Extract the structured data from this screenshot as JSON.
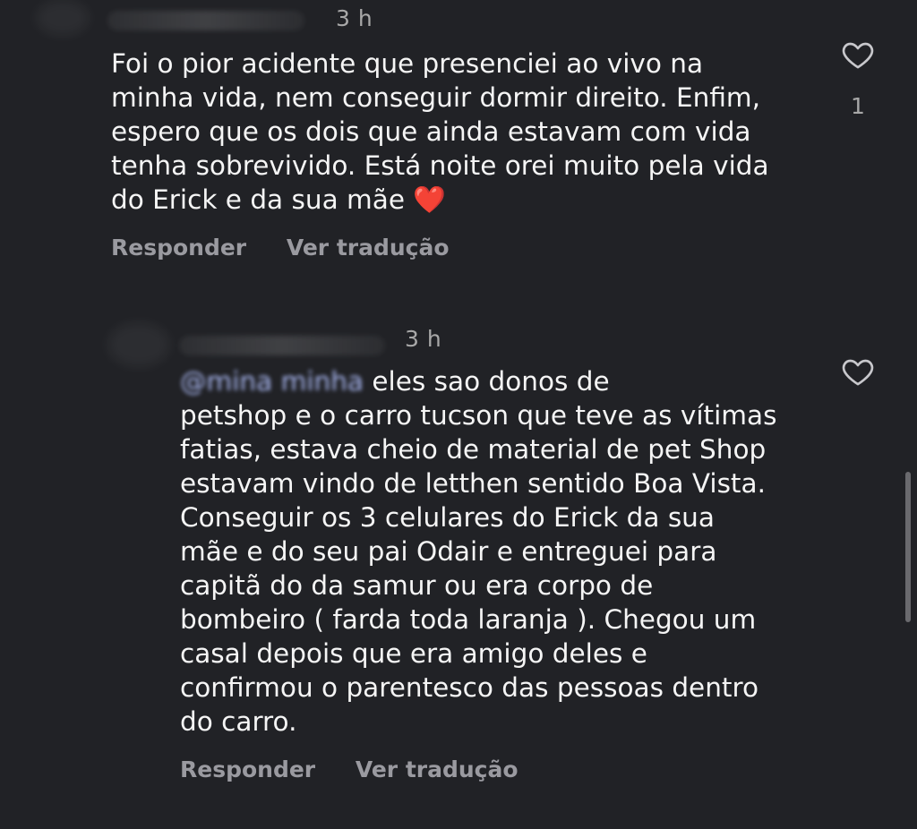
{
  "comments": [
    {
      "timestamp": "3 h",
      "text": "Foi o pior acidente que presenciei ao vivo na\nminha vida, nem conseguir dormir direito. Enfim,\nespero que os dois que ainda estavam com vida\ntenha sobrevivido. Está noite orei muito pela vida\ndo Erick e da sua mãe",
      "emoji": "❤️",
      "like_count": "1",
      "reply_label": "Responder",
      "translate_label": "Ver tradução"
    },
    {
      "timestamp": "3 h",
      "mention": "@mina minha",
      "text": "eles sao donos de\npetshop e o carro tucson que teve as vítimas\nfatias, estava cheio de material de pet Shop\nestavam vindo de letthen sentido Boa Vista.\nConseguir os 3 celulares do Erick da sua\nmãe e do seu pai Odair e entreguei para\ncapitã do da samur ou era corpo de\nbombeiro ( farda toda laranja ). Chegou um\ncasal depois que era amigo deles e\nconfirmou o parentesco das pessoas dentro\ndo carro.",
      "reply_label": "Responder",
      "translate_label": "Ver tradução"
    }
  ],
  "colors": {
    "background": "#212226",
    "text": "#f5f5f5",
    "muted": "#9a9aa0",
    "mention": "#aab8f2"
  },
  "icons": {
    "like": "heart-outline-icon"
  }
}
